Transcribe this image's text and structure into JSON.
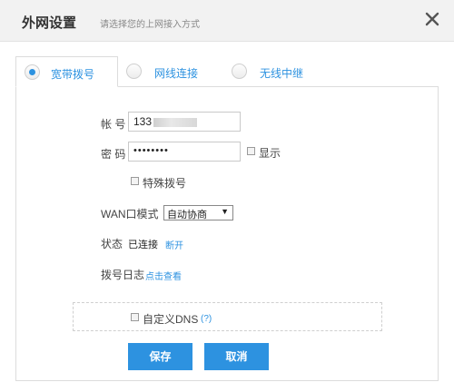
{
  "header": {
    "title": "外网设置",
    "subtitle": "请选择您的上网接入方式",
    "close_icon": "close-icon"
  },
  "tabs": [
    {
      "label": "宽带拨号",
      "selected": true
    },
    {
      "label": "网线连接",
      "selected": false
    },
    {
      "label": "无线中继",
      "selected": false
    }
  ],
  "form": {
    "account_label": "帐 号",
    "account_value": "133",
    "password_label": "密 码",
    "password_value": "••••••••",
    "show_label": "显示",
    "special_dial_label": "特殊拨号",
    "wan_mode_label": "WAN口模式",
    "wan_mode_value": "自动协商",
    "status_label": "状态",
    "status_value": "已连接",
    "disconnect_link": "断开",
    "dial_log_label": "拨号日志",
    "dial_log_link": "点击查看",
    "custom_dns_label": "自定义DNS",
    "help_link": "(?)"
  },
  "buttons": {
    "save": "保存",
    "cancel": "取消"
  },
  "colors": {
    "accent": "#2d92e0",
    "header_bg": "#f2f2f2"
  }
}
